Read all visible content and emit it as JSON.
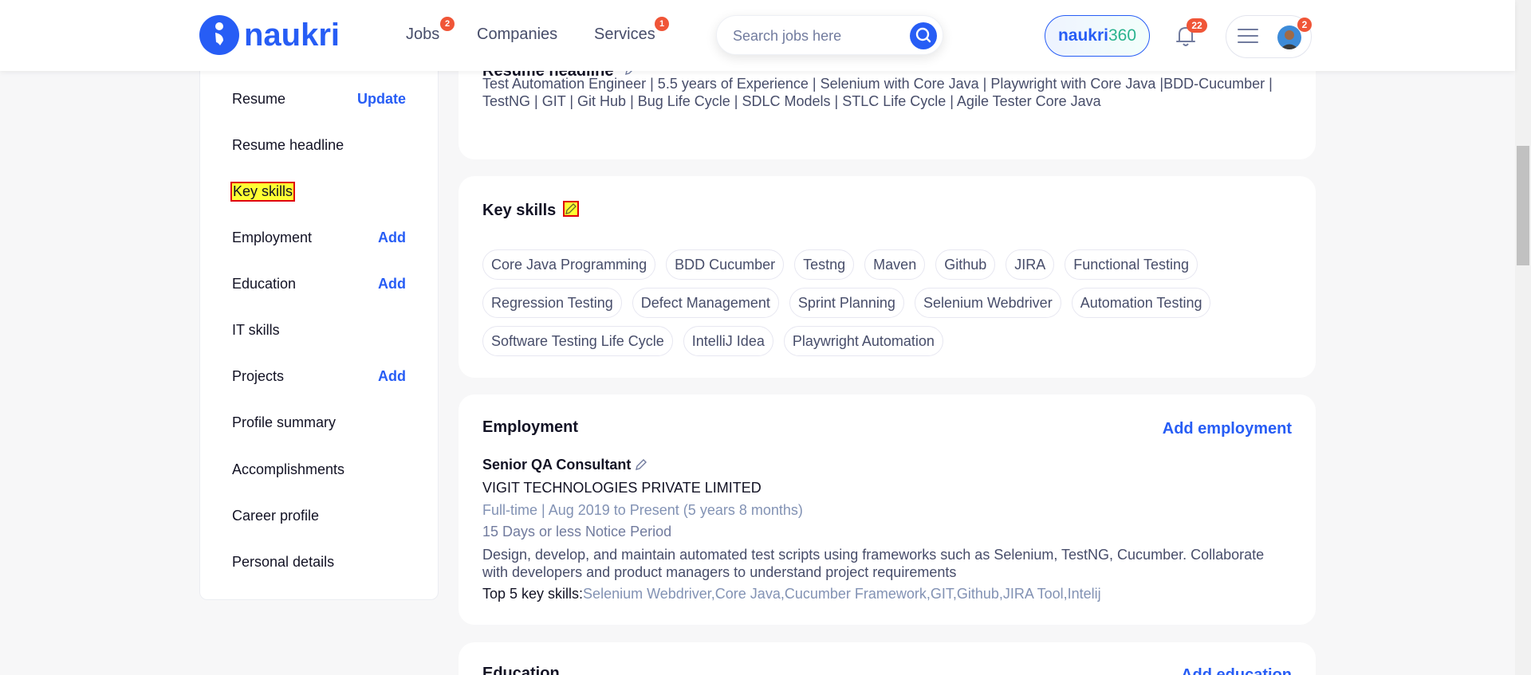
{
  "header": {
    "logo_text": "naukri",
    "nav": [
      {
        "label": "Jobs",
        "badge": "2"
      },
      {
        "label": "Companies",
        "badge": ""
      },
      {
        "label": "Services",
        "badge": "1"
      }
    ],
    "search_placeholder": "Search jobs here",
    "naukri360": {
      "brand": "naukri",
      "num": "360"
    },
    "notification_count": "22",
    "menu_badge": "2"
  },
  "sidebar": {
    "items": [
      {
        "label": "Resume",
        "action": "Update"
      },
      {
        "label": "Resume headline",
        "action": ""
      },
      {
        "label": "Key skills",
        "action": ""
      },
      {
        "label": "Employment",
        "action": "Add"
      },
      {
        "label": "Education",
        "action": "Add"
      },
      {
        "label": "IT skills",
        "action": ""
      },
      {
        "label": "Projects",
        "action": "Add"
      },
      {
        "label": "Profile summary",
        "action": ""
      },
      {
        "label": "Accomplishments",
        "action": ""
      },
      {
        "label": "Career profile",
        "action": ""
      },
      {
        "label": "Personal details",
        "action": ""
      }
    ]
  },
  "resume_headline": {
    "title": "Resume headline",
    "text": "Test Automation Engineer | 5.5 years of Experience | Selenium with Core Java | Playwright with Core Java |BDD-Cucumber | TestNG | GIT | Git Hub | Bug Life Cycle | SDLC Models | STLC Life Cycle | Agile Tester Core Java"
  },
  "key_skills": {
    "title": "Key skills",
    "skills": [
      "Core Java Programming",
      "BDD Cucumber",
      "Testng",
      "Maven",
      "Github",
      "JIRA",
      "Functional Testing",
      "Regression Testing",
      "Defect Management",
      "Sprint Planning",
      "Selenium Webdriver",
      "Automation Testing",
      "Software Testing Life Cycle",
      "IntelliJ Idea",
      "Playwright Automation"
    ]
  },
  "employment": {
    "title": "Employment",
    "add_label": "Add employment",
    "role": "Senior QA Consultant",
    "company": "VIGIT TECHNOLOGIES PRIVATE LIMITED",
    "meta": "Full-time | Aug 2019 to Present (5 years 8 months)",
    "notice": "15 Days or less Notice Period",
    "description": "Design, develop, and maintain automated test scripts using frameworks such as Selenium, TestNG, Cucumber. Collaborate with developers and product managers to understand project requirements",
    "top_skills_label": "Top 5 key skills:",
    "top_skills": "Selenium Webdriver,Core Java,Cucumber Framework,GIT,Github,JIRA Tool,Intelij"
  },
  "education": {
    "title": "Education",
    "add_label": "Add education"
  },
  "colors": {
    "brand_blue": "#275df5",
    "badge_red": "#f05537",
    "highlight_yellow": "#ffff33",
    "highlight_border": "#e0000a"
  }
}
